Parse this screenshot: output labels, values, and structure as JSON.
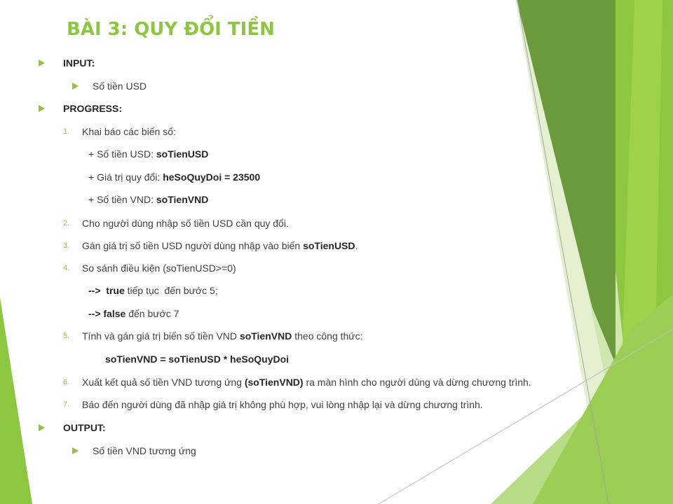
{
  "slide": {
    "title": "BÀI 3: QUY ĐỔI TIỀN",
    "input": {
      "heading": "INPUT:",
      "item": "Số tiền USD"
    },
    "progress": {
      "heading": "PROGRESS:",
      "step1": {
        "num": "1.",
        "text": "Khai báo các biến số:",
        "vars": [
          {
            "label": "+ Số tiền USD: ",
            "value": "soTienUSD"
          },
          {
            "label": "+ Giá trị quy đổi: ",
            "value": "heSoQuyDoi = 23500"
          },
          {
            "label": "+ Số tiền VND: ",
            "value": "soTienVND"
          }
        ]
      },
      "step2": {
        "num": "2.",
        "text": "Cho người dùng nhập số tiền USD cần quy đổi."
      },
      "step3": {
        "num": "3.",
        "text": "Gán giá trị số tiền USD người dùng nhập vào biến ",
        "bold": "soTienUSD",
        "end": "."
      },
      "step4": {
        "num": "4.",
        "text": "So sánh điều kiện (soTienUSD>=0)",
        "true_arrow": "-->  ",
        "true_kw": "true",
        "true_text": " tiếp tục  đến bước 5;",
        "false_arrow": "--> ",
        "false_kw": "false",
        "false_text": " đến bước 7"
      },
      "step5": {
        "num": "5.",
        "text": "Tính và gán giá trị biến số tiền VND ",
        "bold": "soTienVND",
        "end": " theo công thức:",
        "formula": "soTienVND = soTienUSD * heSoQuyDoi"
      },
      "step6": {
        "num": "6.",
        "text": "Xuất kết quả số tiền VND tương ứng ",
        "bold": "(soTienVND)",
        "end": " ra màn hình cho người dùng và dừng chương trình."
      },
      "step7": {
        "num": "7.",
        "text": "Báo đến người dùng đã nhập giá trị không phù hợp, vui lòng nhập lại và dừng chương trình."
      }
    },
    "output": {
      "heading": "OUTPUT:",
      "item": "Số tiền VND tương ứng"
    }
  },
  "colors": {
    "accent": "#8dc63f",
    "text": "#404040"
  }
}
